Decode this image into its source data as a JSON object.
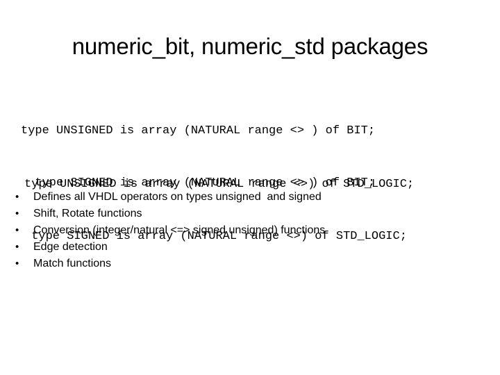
{
  "slide": {
    "title": "numeric_bit, numeric_std packages",
    "background_color": "#ffffff",
    "text_color": "#000000"
  },
  "code_blocks": [
    {
      "id": "numeric-bit-types",
      "lines": [
        "type UNSIGNED is array (NATURAL range <> ) of BIT;",
        "  type SIGNED is array (NATURAL range <> ) of BIT;"
      ]
    },
    {
      "id": "numeric-std-types",
      "lines": [
        "type UNSIGNED is array (NATURAL range <>) of STD_LOGIC;",
        " type SIGNED is array (NATURAL range <>) of STD_LOGIC;"
      ]
    }
  ],
  "bullets": {
    "marker": "•",
    "items": [
      "Defines all VHDL operators on types unsigned  and signed",
      "Shift, Rotate functions",
      "Conversion (integer/natural <=> signed unsigned) functions",
      "Edge detection",
      "Match functions"
    ]
  }
}
